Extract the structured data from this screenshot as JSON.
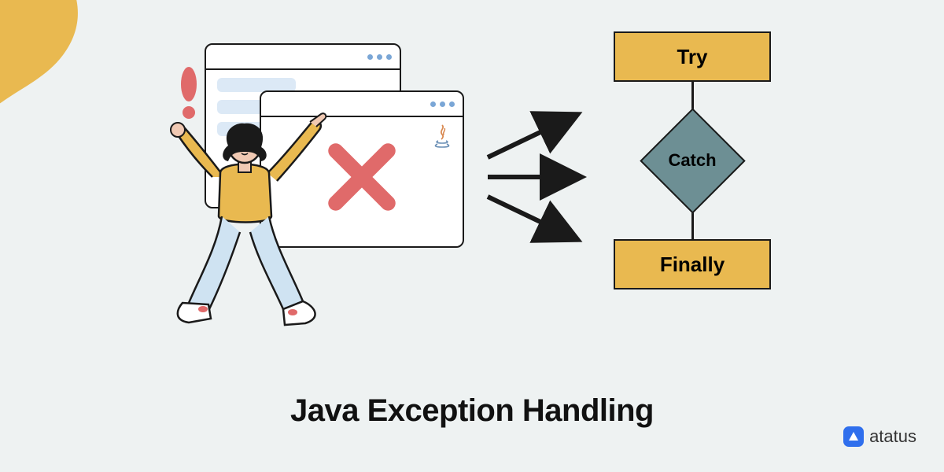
{
  "title": "Java Exception Handling",
  "brand": {
    "name": "atatus",
    "mark": "A"
  },
  "flowchart": {
    "try_label": "Try",
    "catch_label": "Catch",
    "finally_label": "Finally"
  },
  "colors": {
    "box_fill": "#e9b950",
    "diamond_fill": "#6d8f94",
    "bg": "#eef2f2",
    "accent_blob": "#e9b950",
    "error_x": "#e06a6a"
  },
  "icons": {
    "exclamation": "exclamation-icon",
    "error_x": "error-x-icon",
    "java": "java-logo-icon",
    "window_dots": "window-control-dots"
  }
}
